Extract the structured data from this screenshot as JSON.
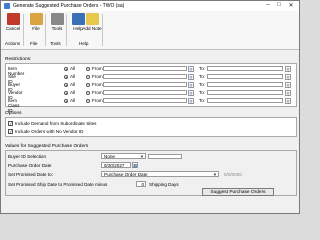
{
  "window": {
    "title": "Generate Suggested Purchase Orders  -  TWO (sa)",
    "controls": [
      "–",
      "□",
      "✕"
    ]
  },
  "toolbar": {
    "buttons": [
      {
        "label": "Cancel",
        "icon": "cancel-icon",
        "color": "#c0392b"
      },
      {
        "label": "File",
        "icon": "file-icon",
        "color": "#d9a441"
      },
      {
        "label": "Tools",
        "icon": "tools-icon",
        "color": "#888888"
      },
      {
        "label": "Help",
        "icon": "help-icon",
        "color": "#3b6fb6"
      },
      {
        "label": "Add Note",
        "icon": "add-note-icon",
        "color": "#e8c84a"
      }
    ],
    "groups": [
      "Actions",
      "File",
      "Tools",
      "Help"
    ]
  },
  "restrictions": {
    "title": "Restrictions:",
    "all_label": "All",
    "from_label": "From:",
    "to_label": "To:",
    "rows": [
      "Item Number",
      "Site ID",
      "Buyer ID",
      "Vendor ID",
      "Item Class ID"
    ]
  },
  "options": {
    "title": "Options",
    "items": [
      "Include Demand from Subordinate Sites",
      "Include Orders with No Vendor ID"
    ]
  },
  "values": {
    "title": "Values for Suggested Purchase Orders",
    "buyer_label": "Buyer ID Selection",
    "buyer_value": "None",
    "po_date_label": "Purchase Order Date",
    "po_date_value": "9/30/2027",
    "promised_label": "Set Promised Date to:",
    "promised_value": "Purchase Order Date",
    "promised_date_value": "0/0/0000",
    "ship_label": "Set Promised Ship Date to Promised Date minus",
    "ship_days": "0",
    "ship_unit": "Shipping Days"
  },
  "actions": {
    "suggest_label": "Suggest Purchase Orders"
  }
}
